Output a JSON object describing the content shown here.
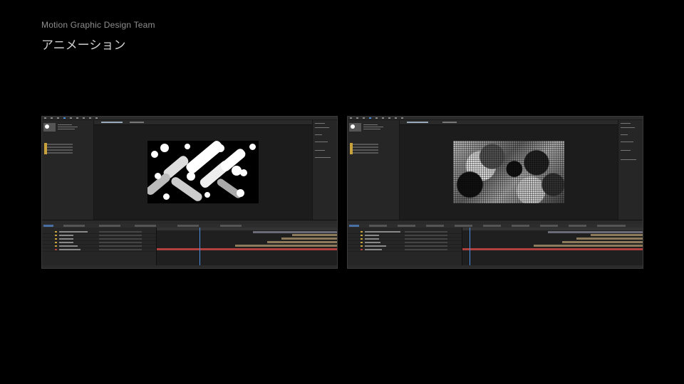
{
  "slide": {
    "subtitle": "Motion Graphic Design Team",
    "title": "アニメーション"
  },
  "screenshots": [
    {
      "name": "after-effects-screenshot-left",
      "composition_style": "white-circles-and-blurred-pills"
    },
    {
      "name": "after-effects-screenshot-right",
      "composition_style": "grayscale-halftone-texture"
    }
  ],
  "colors": {
    "background": "#000000",
    "panel": "#232323",
    "accent_blue": "#4a90e2",
    "layer_label_yellow": "#c9a23c",
    "track_tan": "#8c7a5a",
    "track_red": "#b0413e",
    "track_gray": "#6a6a78"
  }
}
